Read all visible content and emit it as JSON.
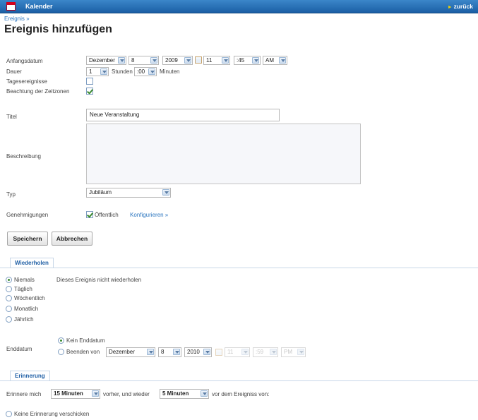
{
  "window": {
    "title": "Kalender",
    "back_label": "zurück"
  },
  "breadcrumb": "Ereignis »",
  "page_title": "Ereignis hinzufügen",
  "start": {
    "label": "Anfangsdatum",
    "month": "Dezember",
    "day": "8",
    "year": "2009",
    "hour": "11",
    "minute": ":45",
    "ampm": "AM"
  },
  "duration": {
    "label": "Dauer",
    "hours": "1",
    "hours_unit": "Stunden",
    "minutes": ":00",
    "minutes_unit": "Minuten"
  },
  "allday": {
    "label": "Tagesereignisse",
    "checked": false
  },
  "timezone": {
    "label": "Beachtung der Zeitzonen",
    "checked": true
  },
  "title_field": {
    "label": "Titel",
    "value": "Neue Veranstaltung"
  },
  "description": {
    "label": "Beschreibung",
    "value": ""
  },
  "type": {
    "label": "Typ",
    "value": "Jubiläum"
  },
  "permissions": {
    "label": "Genehmigungen",
    "public_label": "Öffentlich",
    "public_checked": true,
    "configure_link": "Konfigurieren »"
  },
  "buttons": {
    "save": "Speichern",
    "cancel": "Abbrechen"
  },
  "repeat": {
    "tab": "Wiederholen",
    "options": [
      "Niemals",
      "Täglich",
      "Wöchentlich",
      "Monatlich",
      "Jährlich"
    ],
    "selected": "Niemals",
    "description": "Dieses Ereignis nicht wiederholen",
    "end_label": "Enddatum",
    "no_end_label": "Kein Enddatum",
    "end_on_label": "Beenden von",
    "end_month": "Dezember",
    "end_day": "8",
    "end_year": "2010",
    "end_hour": "11",
    "end_minute": ":59",
    "end_ampm": "PM"
  },
  "reminder": {
    "tab": "Erinnerung",
    "prefix": "Erinnere mich",
    "first": "15 Minuten",
    "middle": "vorher, und wieder",
    "second": "5 Minuten",
    "suffix": "vor dem Ereigniss von:",
    "no_reminder_label": "Keine Erinnerung verschicken"
  }
}
